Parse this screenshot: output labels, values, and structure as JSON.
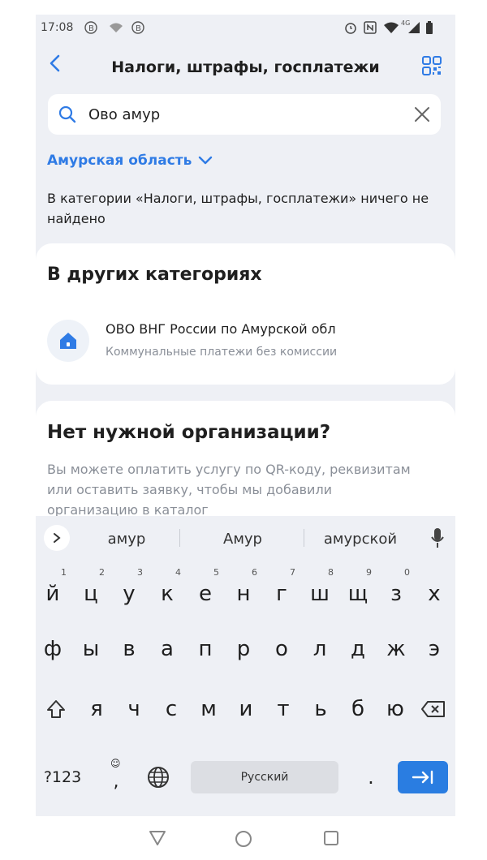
{
  "status_bar": {
    "time": "17:08",
    "left_icons": [
      "b-circle-icon",
      "wifi-off-icon",
      "b-circle-icon"
    ],
    "right_icons": [
      "alarm-icon",
      "nfc-icon",
      "wifi-icon",
      "signal-4g-icon",
      "battery-icon"
    ],
    "network_badge": "4G"
  },
  "header": {
    "title": "Налоги, штрафы, госплатежи"
  },
  "search": {
    "value": "Ово амур",
    "placeholder": ""
  },
  "region": {
    "label": "Амурская область"
  },
  "not_found": {
    "text": "В категории «Налоги, штрафы, госплатежи» ничего не найдено"
  },
  "other_categories": {
    "title": "В других категориях",
    "items": [
      {
        "name": "ОВО ВНГ России по Амурской обл",
        "subtitle": "Коммунальные платежи без комиссии"
      }
    ]
  },
  "missing_org": {
    "title": "Нет нужной организации?",
    "text": "Вы можете оплатить услугу по QR-коду, реквизитам или оставить заявку, чтобы мы добавили организацию в каталог"
  },
  "keyboard": {
    "suggestions": [
      "амур",
      "Амур",
      "амурской"
    ],
    "row1": [
      {
        "ch": "й",
        "hint": "1"
      },
      {
        "ch": "ц",
        "hint": "2"
      },
      {
        "ch": "у",
        "hint": "3"
      },
      {
        "ch": "к",
        "hint": "4"
      },
      {
        "ch": "е",
        "hint": "5"
      },
      {
        "ch": "н",
        "hint": "6"
      },
      {
        "ch": "г",
        "hint": "7"
      },
      {
        "ch": "ш",
        "hint": "8"
      },
      {
        "ch": "щ",
        "hint": "9"
      },
      {
        "ch": "з",
        "hint": "0"
      },
      {
        "ch": "х",
        "hint": ""
      }
    ],
    "row2": [
      "ф",
      "ы",
      "в",
      "а",
      "п",
      "р",
      "о",
      "л",
      "д",
      "ж",
      "э"
    ],
    "row3": [
      "я",
      "ч",
      "с",
      "м",
      "и",
      "т",
      "ь",
      "б",
      "ю"
    ],
    "symbols_label": "?123",
    "comma_label": ",",
    "space_label": "Русский",
    "period_label": "."
  },
  "colors": {
    "accent": "#2f7be5",
    "enter": "#2a7de1",
    "background": "#eef0f5"
  }
}
